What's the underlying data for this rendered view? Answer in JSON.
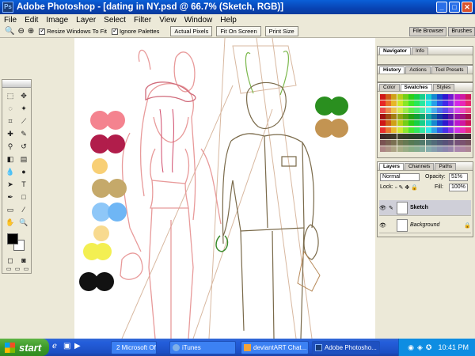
{
  "window": {
    "title": "Adobe Photoshop - [dating in NY.psd @ 66.7% (Sketch, RGB)]",
    "buttons": [
      "minimize",
      "maximize",
      "close"
    ]
  },
  "menu": [
    "File",
    "Edit",
    "Image",
    "Layer",
    "Select",
    "Filter",
    "View",
    "Window",
    "Help"
  ],
  "options": {
    "resize": "Resize Windows To Fit",
    "ignore": "Ignore Palettes",
    "actual": "Actual Pixels",
    "fit": "Fit On Screen",
    "print": "Print Size"
  },
  "palette_well": [
    "File Browser",
    "Brushes"
  ],
  "navigator": {
    "tabs": [
      "Navigator",
      "Info"
    ]
  },
  "history": {
    "tabs": [
      "History",
      "Actions",
      "Tool Presets"
    ]
  },
  "color": {
    "tabs": [
      "Color",
      "Swatches",
      "Styles"
    ]
  },
  "layers": {
    "tabs": [
      "Layers",
      "Channels",
      "Paths"
    ],
    "blend_mode": "Normal",
    "opacity_label": "Opacity:",
    "opacity": "51%",
    "lock_label": "Lock:",
    "fill_label": "Fill:",
    "fill": "100%",
    "rows": [
      {
        "name": "Sketch",
        "selected": true
      },
      {
        "name": "Background",
        "selected": false
      }
    ]
  },
  "palette_colors": {
    "left": [
      [
        "#f4838f",
        "#f4838f"
      ],
      [
        "#b11d4b",
        "#b11d4b"
      ],
      [
        "#f8cf75"
      ],
      [
        "#c5a96a",
        "#c5a96a"
      ],
      [
        "#6fb6f5",
        "#6fb6f5"
      ],
      [
        "#f8da8f"
      ],
      [
        "#f3ef52",
        "#f3ef52"
      ],
      [
        "#121212",
        "#121212"
      ]
    ],
    "right": [
      [
        "#2a8f1f",
        "#2a8f1f"
      ],
      [
        "#c39452",
        "#c39452"
      ]
    ]
  },
  "taskbar": {
    "start": "start",
    "tasks": [
      {
        "label": "2 Microsoft Off...",
        "active": false
      },
      {
        "label": "iTunes",
        "active": false
      },
      {
        "label": "deviantART Chat...",
        "active": false
      },
      {
        "label": "Adobe Photosho...",
        "active": true
      }
    ],
    "clock": "10:41 PM"
  }
}
